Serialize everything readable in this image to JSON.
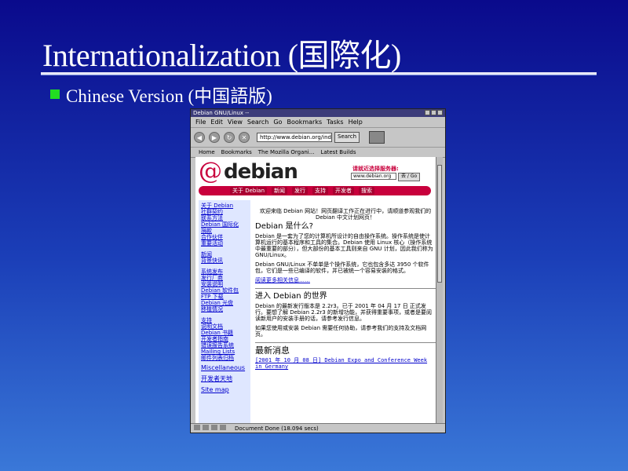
{
  "slide": {
    "title": "Internationalization (国際化)",
    "bullet": "Chinese Version (中国語版)"
  },
  "colors": {
    "bullet": "#22dd22",
    "brand": "#c8003c",
    "sidebar_bg": "#dfe7ff"
  },
  "browser": {
    "window_title": "Debian GNU/Linux --",
    "menu": [
      "File",
      "Edit",
      "View",
      "Search",
      "Go",
      "Bookmarks",
      "Tasks",
      "Help"
    ],
    "url": "http://www.debian.org/ind",
    "search_label": "Search",
    "personal_bar": [
      "Home",
      "Bookmarks",
      "The Mozilla Organi...",
      "Latest Builds"
    ],
    "status": "Document Done (18.094 secs)"
  },
  "page": {
    "logo": "debian",
    "mirror_label": "请就近选择服务器:",
    "mirror_value": "www.debian.org",
    "go_label": "去 / Go",
    "nav": [
      "关于 Debian",
      "新闻",
      "发行",
      "支持",
      "开发者",
      "搜索"
    ],
    "sidebar_groups": [
      [
        "关于 Debian",
        "社群契约",
        "联系方法",
        "Debian 国际化",
        "捐款",
        "合作伙伴",
        "重要活动"
      ],
      [
        "新闻",
        "背景快讯"
      ],
      [
        "系统发布",
        "发行厂商",
        "安装说明",
        "Debian 软件包",
        "FTP 下载",
        "Debian 光盘",
        "移植情况"
      ],
      [
        "支持",
        "说明文档",
        "Debian 书籍",
        "开发者指南",
        "错误报告系统",
        "Mailing Lists",
        "邮件列表归档"
      ]
    ],
    "sidebar_bottom": [
      "Miscellaneous",
      "开发者天地",
      "Site map"
    ],
    "welcome": "欢迎来临 Debian 网站！网页翻译工作正在进行中，请顺道参观我们的 Debian 中文计划网页！",
    "what_heading": "Debian 是什么?",
    "what_p1": "Debian 是一套为了您的计算机所设计的自由操作系统。操作系统是使计算机运行的基本程序和工具的集合。Debian 使用 Linux 核心（操作系统中最重要的部分），但大部份的基本工具则来自 GNU 计划，因此我们称为 GNU/Linux。",
    "what_p2": "Debian GNU/Linux 不单单是个操作系统，它也包含多达 3950 个软件包，它们是一些已编译的软件，并已被统一个容易安装的格式。",
    "more_link": "阅读更多相关信息……",
    "enter_heading": "进入 Debian 的世界",
    "enter_p1": "Debian 的最新发行版本是 2.2r3。已于 2001 年 04 月 17 日 正式发行。要想了解 Debian 2.2r3 的新增功能，并获得重要事项，或者是要阅读新用户的安装手册的话，请参考发行信息。",
    "enter_p2": "如果您使用或安装 Debian 需要任何协助，请参考我们的支持及文档网页。",
    "news_heading": "最新消息",
    "news_item": "[2001 年 10 月 08 日] Debian Expo and Conference Week in Germany"
  }
}
